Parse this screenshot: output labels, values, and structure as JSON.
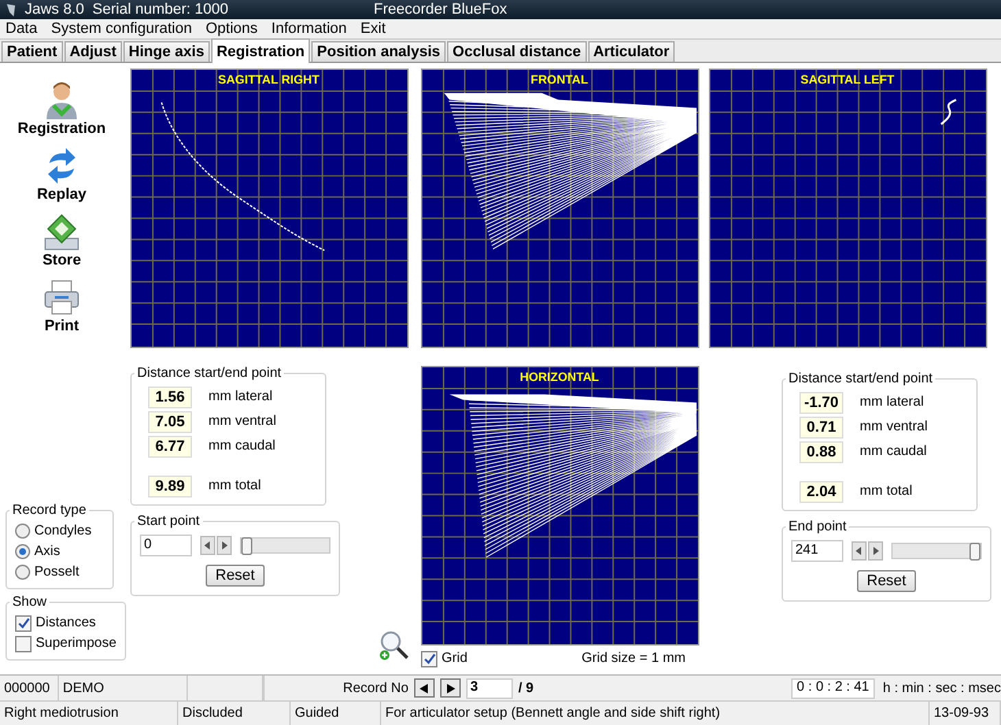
{
  "window": {
    "app": "Jaws 8.0",
    "serial": "Serial number: 1000",
    "device": "Freecorder BlueFox"
  },
  "menu": [
    "Data",
    "System configuration",
    "Options",
    "Information",
    "Exit"
  ],
  "tabs": [
    {
      "label": "Patient",
      "selected": false
    },
    {
      "label": "Adjust",
      "selected": false
    },
    {
      "label": "Hinge axis",
      "selected": false
    },
    {
      "label": "Registration",
      "selected": true
    },
    {
      "label": "Position analysis",
      "selected": false
    },
    {
      "label": "Occlusal distance",
      "selected": false
    },
    {
      "label": "Articulator",
      "selected": false
    }
  ],
  "toolbar": [
    {
      "kind": "person",
      "label": "Registration"
    },
    {
      "kind": "replay",
      "label": "Replay"
    },
    {
      "kind": "store",
      "label": "Store"
    },
    {
      "kind": "print",
      "label": "Print"
    }
  ],
  "plots": [
    {
      "kind": "sagittal_right",
      "title": "SAGITTAL RIGHT"
    },
    {
      "kind": "frontal",
      "title": "FRONTAL"
    },
    {
      "kind": "sagittal_left",
      "title": "SAGITTAL LEFT"
    },
    {
      "kind": "horizontal",
      "title": "HORIZONTAL"
    }
  ],
  "distance_left": {
    "title": "Distance start/end point",
    "rows": [
      {
        "value": "1.56",
        "unit": "mm lateral"
      },
      {
        "value": "7.05",
        "unit": "mm ventral"
      },
      {
        "value": "6.77",
        "unit": "mm caudal"
      },
      {
        "value": "9.89",
        "unit": "mm total"
      }
    ]
  },
  "start_point": {
    "title": "Start point",
    "value": "0",
    "level": 0,
    "button": "Reset"
  },
  "distance_right": {
    "title": "Distance start/end point",
    "rows": [
      {
        "value": "-1.70",
        "unit": "mm lateral"
      },
      {
        "value": "0.71",
        "unit": "mm ventral"
      },
      {
        "value": "0.88",
        "unit": "mm caudal"
      },
      {
        "value": "2.04",
        "unit": "mm total"
      }
    ]
  },
  "end_point": {
    "title": "End point",
    "value": "241",
    "level": 1,
    "button": "Reset"
  },
  "record_type": {
    "title": "Record type",
    "options": [
      {
        "label": "Condyles",
        "selected": false
      },
      {
        "label": "Axis",
        "selected": true
      },
      {
        "label": "Posselt",
        "selected": false
      }
    ]
  },
  "show": {
    "title": "Show",
    "options": [
      {
        "label": "Distances",
        "checked": true
      },
      {
        "label": "Superimpose",
        "checked": false
      }
    ]
  },
  "grid": {
    "label": "Grid",
    "checked": true,
    "size": "Grid size = 1 mm"
  },
  "status_bar": {
    "id": "000000",
    "mode": "DEMO",
    "record_label": "Record No",
    "record": "3",
    "record_total": "/ 9",
    "time": "0 : 0 : 2 : 41",
    "time_format": "h : min : sec : msec"
  },
  "info_bar": [
    "Right mediotrusion",
    "Discluded",
    "Guided",
    "For articulator setup (Bennett angle and side shift right)",
    "13-09-93"
  ]
}
